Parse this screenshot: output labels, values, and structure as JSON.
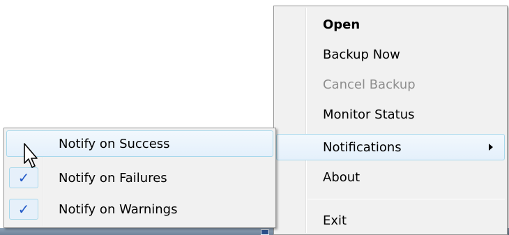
{
  "main_menu": {
    "items": [
      {
        "label": "Open",
        "style": "bold"
      },
      {
        "label": "Backup Now",
        "style": "normal"
      },
      {
        "label": "Cancel Backup",
        "style": "disabled"
      },
      {
        "label": "Monitor Status",
        "style": "normal"
      },
      {
        "label": "Notifications",
        "style": "highlighted",
        "has_submenu": true
      },
      {
        "label": "About",
        "style": "normal"
      },
      {
        "label": "Exit",
        "style": "normal"
      }
    ]
  },
  "sub_menu": {
    "items": [
      {
        "label": "Notify on Success",
        "checked": false,
        "highlighted": true
      },
      {
        "label": "Notify on Failures",
        "checked": true
      },
      {
        "label": "Notify on Warnings",
        "checked": true
      }
    ],
    "check_glyph": "✓"
  },
  "colors": {
    "menu_bg": "#f1f1f1",
    "highlight_border": "#a8d8eb",
    "check_color": "#2259c8",
    "disabled_text": "#8d8d8d"
  }
}
